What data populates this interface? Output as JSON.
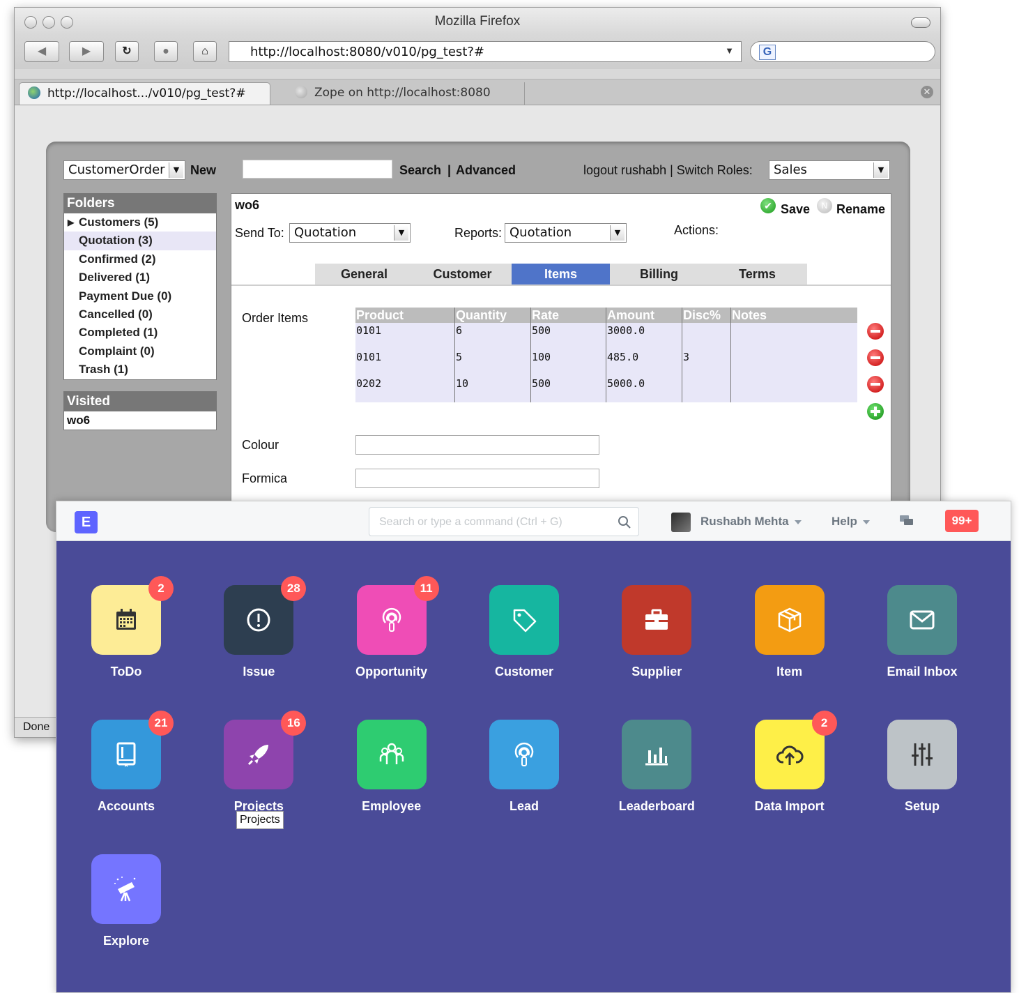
{
  "browser": {
    "title": "Mozilla Firefox",
    "url": "http://localhost:8080/v010/pg_test?#",
    "search_engine": "G",
    "tabs": [
      {
        "label": "http://localhost.../v010/pg_test?#",
        "active": true
      },
      {
        "label": "Zope on http://localhost:8080",
        "active": false
      }
    ],
    "status": "Done"
  },
  "legacy_app": {
    "doctype_select": "CustomerOrder",
    "new_label": "New",
    "search_label": "Search",
    "separator": "|",
    "advanced_label": "Advanced",
    "logout_text": "logout rushabh | Switch Roles:",
    "role_select": "Sales",
    "folders": {
      "title": "Folders",
      "items": [
        {
          "label": "Customers (5)",
          "expandable": true
        },
        {
          "label": "Quotation (3)",
          "selected": true
        },
        {
          "label": "Confirmed (2)"
        },
        {
          "label": "Delivered (1)"
        },
        {
          "label": "Payment Due (0)"
        },
        {
          "label": "Cancelled (0)"
        },
        {
          "label": "Completed (1)"
        },
        {
          "label": "Complaint (0)"
        },
        {
          "label": "Trash (1)"
        }
      ]
    },
    "visited": {
      "title": "Visited",
      "items": [
        "wo6"
      ]
    },
    "form": {
      "record_name": "wo6",
      "save_label": "Save",
      "rename_label": "Rename",
      "send_to_label": "Send To:",
      "send_to_value": "Quotation",
      "reports_label": "Reports:",
      "reports_value": "Quotation",
      "actions_label": "Actions:",
      "tabs": [
        "General",
        "Customer",
        "Items",
        "Billing",
        "Terms"
      ],
      "active_tab": "Items",
      "order_items_label": "Order Items",
      "columns": [
        "Product",
        "Quantity",
        "Rate",
        "Amount",
        "Disc%",
        "Notes"
      ],
      "rows": [
        [
          "0101",
          "6",
          "500",
          "3000.0",
          "",
          ""
        ],
        [
          "0101",
          "5",
          "100",
          "485.0",
          "3",
          ""
        ],
        [
          "0202",
          "10",
          "500",
          "5000.0",
          "",
          ""
        ]
      ],
      "colour_label": "Colour",
      "formica_label": "Formica"
    }
  },
  "desk": {
    "logo": "E",
    "search_placeholder": "Search or type a command (Ctrl + G)",
    "user_name": "Rushabh Mehta",
    "help_label": "Help",
    "notifications": "99+",
    "tooltip": "Projects",
    "modules": [
      {
        "label": "ToDo",
        "badge": "2",
        "color": "#fdec96",
        "icon": "calendar-icon"
      },
      {
        "label": "Issue",
        "badge": "28",
        "color": "#2d3e50",
        "icon": "alert-icon"
      },
      {
        "label": "Opportunity",
        "badge": "11",
        "color": "#ef4db6",
        "icon": "broadcast-icon"
      },
      {
        "label": "Customer",
        "badge": "",
        "color": "#16b6a0",
        "icon": "tag-icon"
      },
      {
        "label": "Supplier",
        "badge": "",
        "color": "#c0392b",
        "icon": "briefcase-icon"
      },
      {
        "label": "Item",
        "badge": "",
        "color": "#f39c12",
        "icon": "box-icon"
      },
      {
        "label": "Email Inbox",
        "badge": "",
        "color": "#4d8a8c",
        "icon": "envelope-icon"
      },
      {
        "label": "Accounts",
        "badge": "21",
        "color": "#3498db",
        "icon": "book-icon"
      },
      {
        "label": "Projects",
        "badge": "16",
        "color": "#8e44ad",
        "icon": "rocket-icon"
      },
      {
        "label": "Employee",
        "badge": "",
        "color": "#2ecc71",
        "icon": "users-icon"
      },
      {
        "label": "Lead",
        "badge": "",
        "color": "#3aa0e0",
        "icon": "broadcast-icon"
      },
      {
        "label": "Leaderboard",
        "badge": "",
        "color": "#4d8a8c",
        "icon": "bar-chart-icon"
      },
      {
        "label": "Data Import",
        "badge": "2",
        "color": "#feef48",
        "icon": "cloud-upload-icon"
      },
      {
        "label": "Setup",
        "badge": "",
        "color": "#bdc3c7",
        "icon": "sliders-icon"
      },
      {
        "label": "Explore",
        "badge": "",
        "color": "#7575ff",
        "icon": "telescope-icon"
      }
    ]
  }
}
